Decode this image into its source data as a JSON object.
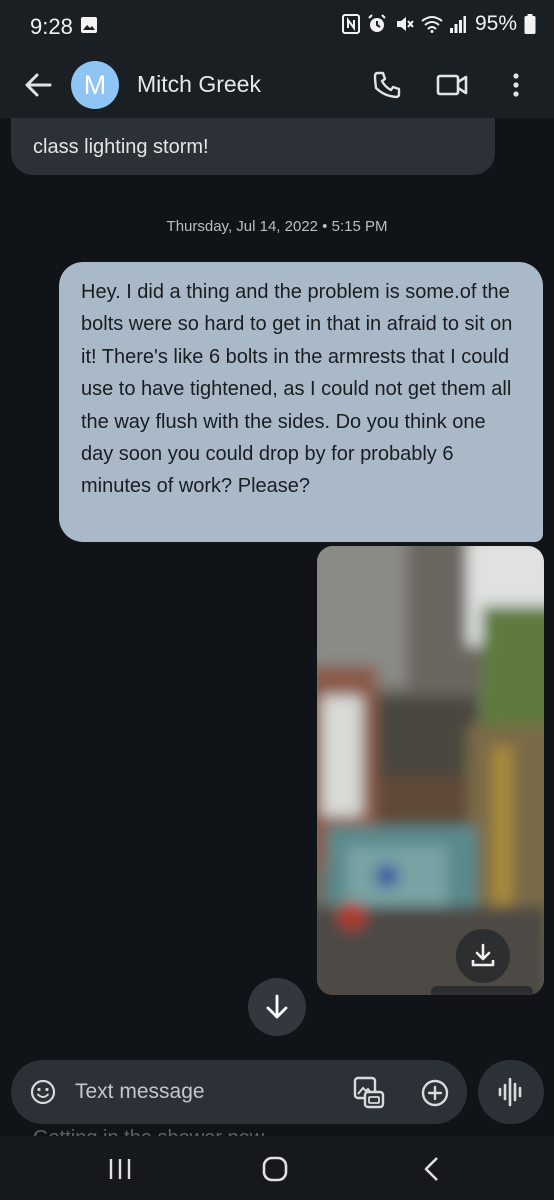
{
  "status_bar": {
    "time": "9:28",
    "battery_percent": "95%",
    "icons": [
      "gallery-icon",
      "nfc-icon",
      "alarm-icon",
      "mute-icon",
      "wifi-icon",
      "signal-icon",
      "battery-icon"
    ]
  },
  "app_bar": {
    "avatar_letter": "M",
    "contact_name": "Mitch Greek",
    "actions": [
      "back-arrow-icon",
      "phone-icon",
      "video-call-icon",
      "more-vert-icon"
    ]
  },
  "conversation": {
    "incoming_snippet": "class lighting storm!",
    "date_divider": "Thursday, Jul 14, 2022 • 5:15 PM",
    "outgoing_message": "Hey.  I did a thing and the problem is some.of the bolts were so hard to get in that in afraid to sit on it!  There's like 6 bolts in the armrests that I could use to have tightened, as I could not get them all the way flush with the sides.  Do you think one day soon you could drop by for probably 6 minutes of work? Please?",
    "image_attachment": {
      "save_label": "Tap to save"
    }
  },
  "compose": {
    "placeholder": "Text message",
    "preview_text": "Getting in the shower now"
  },
  "colors": {
    "background": "#101418",
    "incoming_bubble": "#2c3137",
    "outgoing_bubble": "#a9b9c7",
    "avatar": "#8ec5f5"
  }
}
